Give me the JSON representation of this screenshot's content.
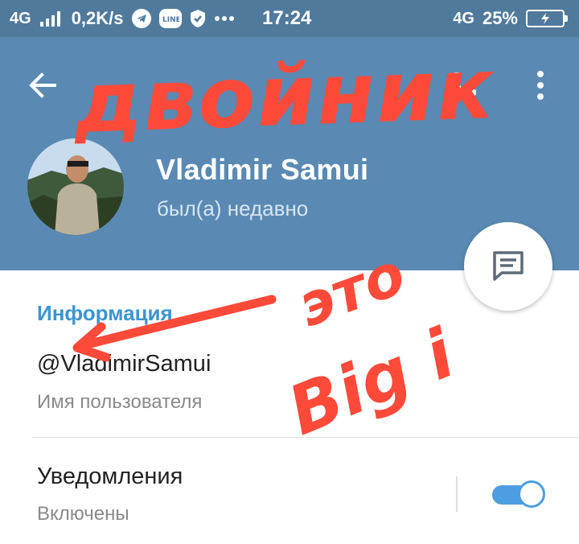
{
  "status_bar": {
    "network_left": "4G",
    "speed": "0,2K/s",
    "time": "17:24",
    "network_right": "4G",
    "battery": "25%",
    "icons": [
      "signal-icon",
      "telegram-icon",
      "line-icon",
      "shield-icon",
      "more-dots-icon",
      "battery-icon"
    ]
  },
  "header": {
    "name": "Vladimir Samui",
    "status": "был(а) недавно",
    "actions": [
      "back-arrow-icon",
      "phone-icon",
      "more-vert-icon"
    ]
  },
  "fab": {
    "icon": "message-icon"
  },
  "info": {
    "section_title": "Информация",
    "username": "@VladimirSamui",
    "username_caption": "Имя пользователя"
  },
  "notifications": {
    "title": "Уведомления",
    "caption": "Включены",
    "enabled": true
  },
  "annotations": {
    "top": "двойник",
    "middle": "это",
    "bottom": "Big i"
  },
  "colors": {
    "header": "#5a8ab3",
    "status_bar": "#507a9c",
    "accent": "#3a95d1",
    "toggle": "#4d9ee0",
    "annotation": "#ff4a3a"
  }
}
